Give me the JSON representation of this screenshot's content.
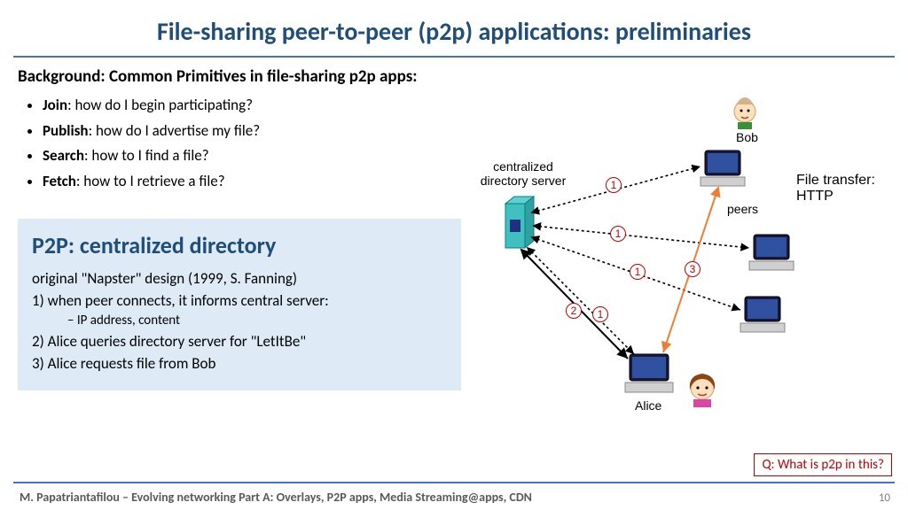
{
  "title": "File-sharing peer-to-peer (p2p) applications: preliminaries",
  "background": {
    "heading": "Background: Common Primitives in file-sharing  p2p apps:",
    "items": [
      {
        "term": "Join",
        "desc": ": how do I begin participating?"
      },
      {
        "term": "Publish",
        "desc": ": how do I advertise my file?"
      },
      {
        "term": "Search",
        "desc": ": how to I find a file?"
      },
      {
        "term": "Fetch",
        "desc": ": how to I retrieve a file?"
      }
    ]
  },
  "box": {
    "title": "P2P: centralized directory",
    "line0": "original \"Napster\" design (1999,  S.  Fanning)",
    "line1": "1) when peer connects, it informs central server:",
    "line1a": "–   IP address, content",
    "line2": "2) Alice queries directory server for \"LetItBe\"",
    "line3": "3) Alice requests file from Bob"
  },
  "diagram": {
    "server_label": "centralized directory server",
    "bob": "Bob",
    "alice": "Alice",
    "peers": "peers",
    "transfer": "File transfer: HTTP",
    "n1": "1",
    "n2": "2",
    "n3": "3"
  },
  "question": "Q: What is p2p in this?",
  "footer": "M. Papatriantafilou –  Evolving networking Part A: Overlays, P2P apps, Media Streaming@apps, CDN",
  "page": "10"
}
